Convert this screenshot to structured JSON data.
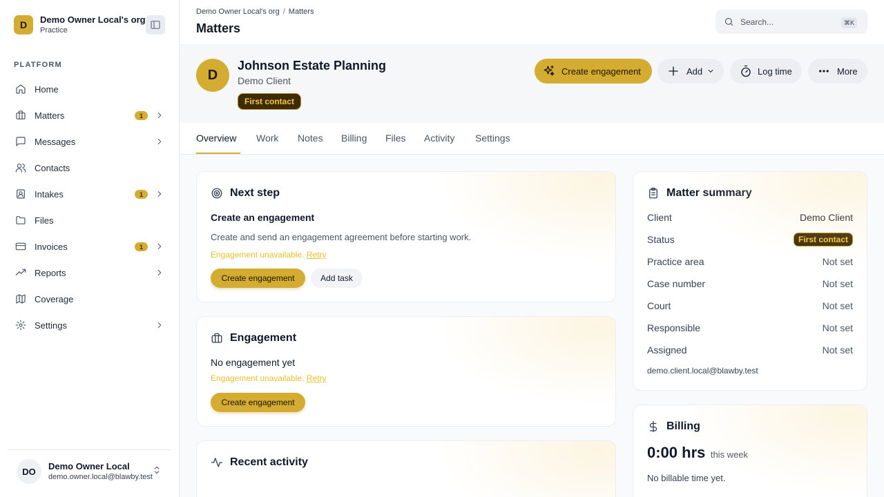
{
  "org": {
    "avatar": "D",
    "name": "Demo Owner Local's org",
    "subtitle": "Practice"
  },
  "sidebar": {
    "section_label": "PLATFORM",
    "items": [
      {
        "label": "Home",
        "icon": "home-icon",
        "badge": null,
        "chevron": false
      },
      {
        "label": "Matters",
        "icon": "briefcase-icon",
        "badge": "1",
        "chevron": true
      },
      {
        "label": "Messages",
        "icon": "message-square-icon",
        "badge": null,
        "chevron": true
      },
      {
        "label": "Contacts",
        "icon": "users-icon",
        "badge": null,
        "chevron": false
      },
      {
        "label": "Intakes",
        "icon": "contact-card-icon",
        "badge": "1",
        "chevron": true
      },
      {
        "label": "Files",
        "icon": "folder-icon",
        "badge": null,
        "chevron": false
      },
      {
        "label": "Invoices",
        "icon": "credit-card-icon",
        "badge": "1",
        "chevron": true
      },
      {
        "label": "Reports",
        "icon": "trending-up-icon",
        "badge": null,
        "chevron": true
      },
      {
        "label": "Coverage",
        "icon": "map-icon",
        "badge": null,
        "chevron": false
      },
      {
        "label": "Settings",
        "icon": "gear-icon",
        "badge": null,
        "chevron": true
      }
    ]
  },
  "user": {
    "initials": "DO",
    "name": "Demo Owner Local",
    "email": "demo.owner.local@blawby.test"
  },
  "topbar": {
    "breadcrumb": [
      "Demo Owner Local's org",
      "Matters"
    ],
    "breadcrumb_sep": "/",
    "title": "Matters",
    "search_placeholder": "Search...",
    "search_shortcut": "⌘K"
  },
  "matter": {
    "avatar": "D",
    "title": "Johnson Estate Planning",
    "client": "Demo Client",
    "status": "First contact",
    "actions": {
      "create_engagement": "Create engagement",
      "add": "Add",
      "log_time": "Log time",
      "more": "More"
    }
  },
  "tabs": [
    "Overview",
    "Work",
    "Notes",
    "Billing",
    "Files",
    "Activity",
    "Settings"
  ],
  "next_step": {
    "title": "Next step",
    "heading": "Create an engagement",
    "description": "Create and send an engagement agreement before starting work.",
    "warning": "Engagement unavailable.",
    "retry": "Retry",
    "primary_button": "Create engagement",
    "secondary_button": "Add task"
  },
  "engagement": {
    "title": "Engagement",
    "empty": "No engagement yet",
    "warning": "Engagement unavailable.",
    "retry": "Retry",
    "button": "Create engagement"
  },
  "recent_activity": {
    "title": "Recent activity"
  },
  "summary": {
    "title": "Matter summary",
    "rows": [
      {
        "label": "Client",
        "value": "Demo Client"
      },
      {
        "label": "Status",
        "value": "First contact"
      },
      {
        "label": "Practice area",
        "value": "Not set"
      },
      {
        "label": "Case number",
        "value": "Not set"
      },
      {
        "label": "Court",
        "value": "Not set"
      },
      {
        "label": "Responsible",
        "value": "Not set"
      },
      {
        "label": "Assigned",
        "value": "Not set"
      }
    ],
    "email": "demo.client.local@blawby.test"
  },
  "billing": {
    "title": "Billing",
    "hours": "0:00 hrs",
    "period": "this week",
    "empty": "No billable time yet."
  },
  "colors": {
    "accent": "#d4ac31",
    "status_bg": "#3d2b05",
    "status_text": "#f5c542",
    "warning": "#e6c12c"
  }
}
